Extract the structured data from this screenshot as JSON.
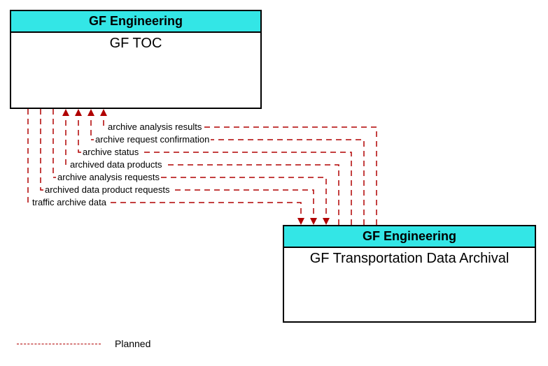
{
  "nodes": {
    "top": {
      "org": "GF Engineering",
      "name": "GF TOC"
    },
    "bottom": {
      "org": "GF Engineering",
      "name": "GF Transportation Data Archival"
    }
  },
  "flows": {
    "to_bottom": [
      "traffic archive data",
      "archived data product requests",
      "archive analysis requests"
    ],
    "to_top": [
      "archived data products",
      "archive status",
      "archive request confirmation",
      "archive analysis results"
    ]
  },
  "legend": {
    "planned": "Planned"
  }
}
